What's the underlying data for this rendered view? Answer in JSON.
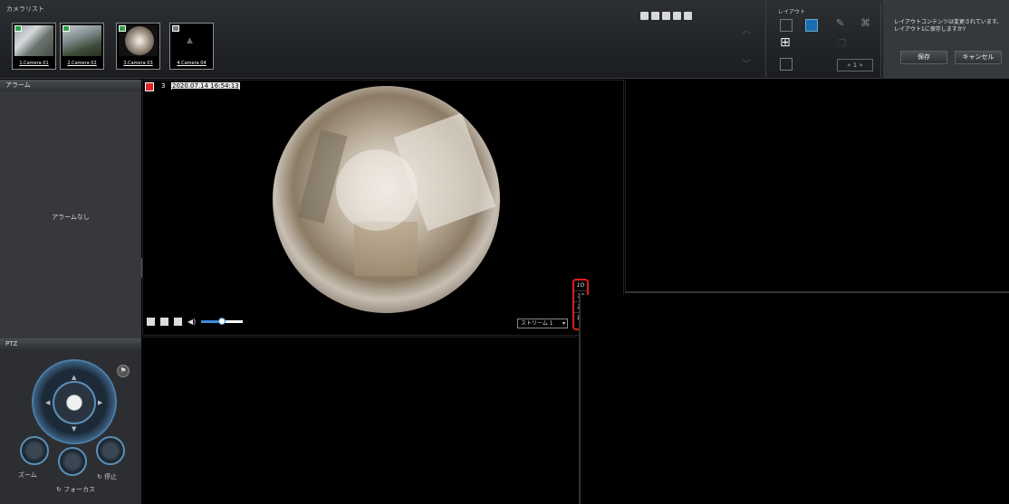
{
  "camera_list": {
    "title": "カメラリスト",
    "cameras": [
      {
        "label": "1.Camera 01",
        "status": "live"
      },
      {
        "label": "2.Camera 02",
        "status": "live"
      },
      {
        "label": "3.Camera 03",
        "status": "live"
      },
      {
        "label": "4.Camera 04",
        "status": "no-image"
      }
    ]
  },
  "layout": {
    "title": "レイアウト",
    "page": "1"
  },
  "save_dialog": {
    "message": "レイアウトコンテンツは変更されています。レイアウト1に保存しますか?",
    "save_label": "保存",
    "cancel_label": "キャンセル"
  },
  "alarm": {
    "title": "アラーム",
    "empty_text": "アラームなし"
  },
  "video": {
    "camera_number": "3",
    "timestamp": "2020.07.14 16:54:13",
    "stream_select": "ストリーム 1",
    "ratio_options": [
      "1O",
      "1P",
      "1R",
      "1O"
    ],
    "annotation_number": "①"
  },
  "ptz": {
    "title": "PTZ",
    "zoom_label": "ズーム",
    "focus_label": "フォーカス",
    "stop_label": "停止"
  },
  "colors": {
    "accent_blue": "#3a8cd8",
    "highlight_red": "#e11d1d",
    "status_green": "#2aa34a"
  }
}
